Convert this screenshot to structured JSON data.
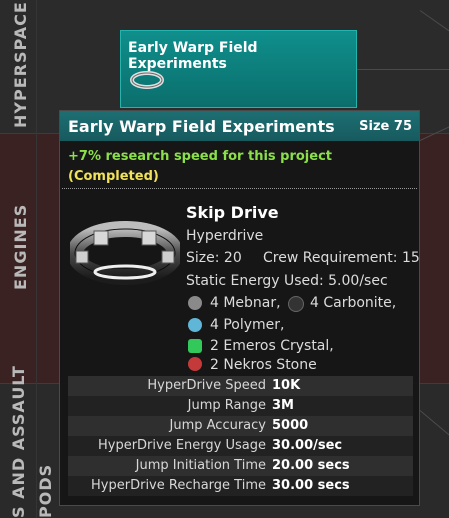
{
  "sections": {
    "hyperspace": "HYPERSPACE TECH",
    "engines": "ENGINES",
    "assault": "S AND ASSAULT",
    "pods": "PODS"
  },
  "project_card": {
    "title": "Early Warp Field Experiments"
  },
  "tooltip": {
    "title": "Early Warp Field Experiments",
    "size": "Size 75",
    "bonus": "+7% research speed for this project",
    "status": "(Completed)",
    "component": {
      "name": "Skip Drive",
      "type": "Hyperdrive",
      "size": "Size: 20",
      "crew": "Crew Requirement: 15",
      "energy": "Static Energy Used: 5.00/sec",
      "resources": [
        {
          "label": "4 Mebnar,",
          "icon": "mebnar-icon",
          "color": "#8a8a8a"
        },
        {
          "label": "4 Carbonite,",
          "icon": "carbonite-icon",
          "color": "#3a3a3a"
        },
        {
          "label": "4 Polymer,",
          "icon": "polymer-icon",
          "color": "#5fb6d6"
        },
        {
          "label": "2 Emeros Crystal,",
          "icon": "emeros-crystal-icon",
          "color": "#33c85a"
        },
        {
          "label": "2 Nekros Stone",
          "icon": "nekros-stone-icon",
          "color": "#c43a3a"
        }
      ]
    },
    "stats": [
      {
        "label": "HyperDrive Speed",
        "value": "10K"
      },
      {
        "label": "Jump Range",
        "value": "3M"
      },
      {
        "label": "Jump Accuracy",
        "value": "5000"
      },
      {
        "label": "HyperDrive Energy Usage",
        "value": "30.00/sec"
      },
      {
        "label": "Jump Initiation Time",
        "value": "20.00 secs"
      },
      {
        "label": "HyperDrive Recharge Time",
        "value": "30.00 secs"
      }
    ]
  }
}
